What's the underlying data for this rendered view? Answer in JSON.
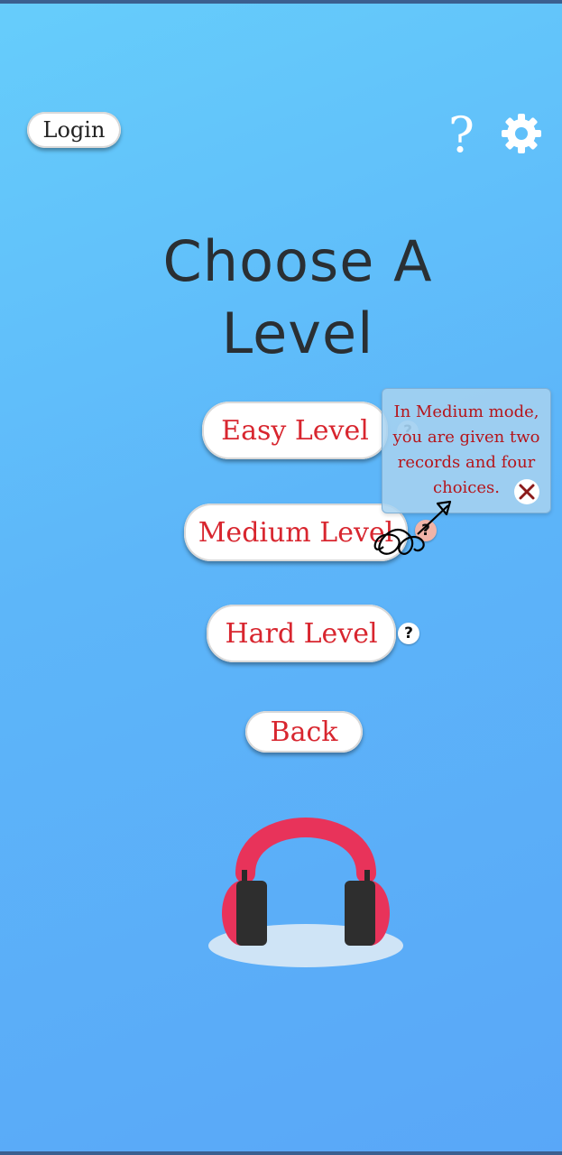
{
  "header": {
    "login_label": "Login",
    "help_label": "?"
  },
  "main": {
    "title_line1": "Choose A",
    "title_line2": "Level",
    "levels": [
      {
        "label": "Easy Level",
        "help": "?"
      },
      {
        "label": "Medium Level",
        "help": "?"
      },
      {
        "label": "Hard Level",
        "help": "?"
      }
    ],
    "back_label": "Back"
  },
  "tooltip": {
    "text": "In Medium mode, you are given two records and four choices."
  },
  "icons": {
    "help": "question-mark-icon",
    "settings": "gear-icon",
    "close": "close-icon",
    "illustration": "headphones-icon"
  },
  "colors": {
    "accent": "#d8262f",
    "background_top": "#66cdfb",
    "background_bottom": "#59a7f8",
    "headphones": "#e8335a"
  }
}
